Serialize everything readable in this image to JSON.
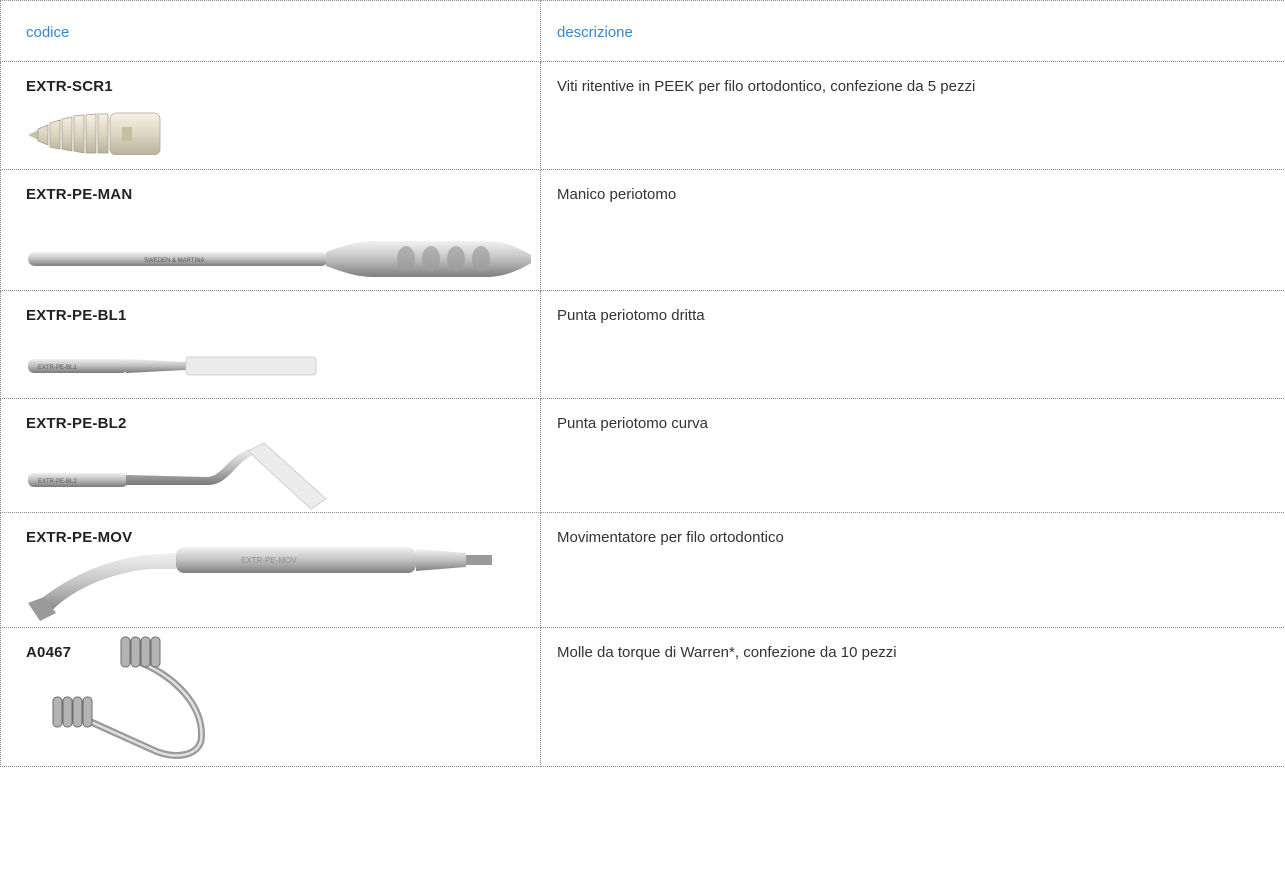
{
  "table": {
    "headers": {
      "code": "codice",
      "description": "descrizione"
    },
    "rows": [
      {
        "code": "EXTR-SCR1",
        "description": "Viti ritentive in PEEK per filo ortodontico, confezione da 5 pezzi",
        "image": "peek-retention-screw-image"
      },
      {
        "code": "EXTR-PE-MAN",
        "description": "Manico periotomo",
        "image": "periotome-handle-image",
        "engraving": "SWEDEN & MARTINA"
      },
      {
        "code": "EXTR-PE-BL1",
        "description": "Punta periotomo dritta",
        "image": "straight-periotome-tip-image",
        "engraving": "EXTR-PE-BL1"
      },
      {
        "code": "EXTR-PE-BL2",
        "description": "Punta periotomo curva",
        "image": "curved-periotome-tip-image",
        "engraving": "EXTR-PE-BL2"
      },
      {
        "code": "EXTR-PE-MOV",
        "description": "Movimentatore per filo ortodontico",
        "image": "wire-mover-tool-image",
        "engraving": "EXTR-PE-MOV"
      },
      {
        "code": "A0467",
        "description": "Molle da torque di Warren*, confezione da 10 pezzi",
        "image": "warren-torque-spring-image"
      }
    ]
  },
  "colors": {
    "header_text": "#3a86c8",
    "border": "#8a8a8a"
  }
}
